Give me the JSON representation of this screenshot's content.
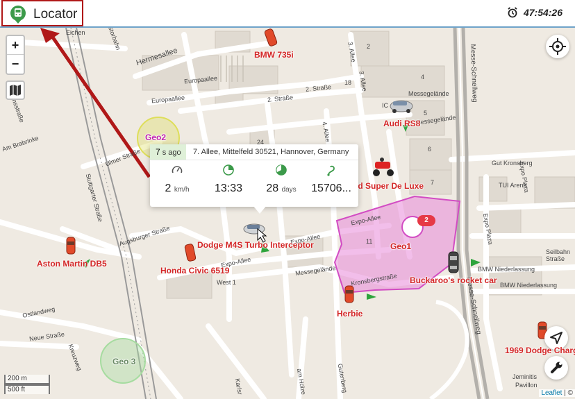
{
  "app": {
    "title": "Locator",
    "clock": "47:54:26"
  },
  "controls": {
    "zoom_in": "+",
    "zoom_out": "−"
  },
  "popup": {
    "ago_value": "7",
    "ago_unit": "s ago",
    "address": "7. Allee, Mittelfeld 30521, Hannover, Germany",
    "speed_value": "2",
    "speed_unit": "km/h",
    "time": "13:33",
    "days_value": "28",
    "days_unit": "days",
    "odometer": "15706..."
  },
  "vehicles": [
    {
      "name": "BMW 735i"
    },
    {
      "name": "Audi RS8"
    },
    {
      "name": "Ford Super De Luxe"
    },
    {
      "name": "Dodge M4S Turbo Interceptor"
    },
    {
      "name": "Honda Civic 6519"
    },
    {
      "name": "Aston Martin DB5"
    },
    {
      "name": "Buckaroo's rocket car"
    },
    {
      "name": "Herbie"
    },
    {
      "name": "1969 Dodge Charg"
    }
  ],
  "geofences": [
    {
      "name": "Geo2"
    },
    {
      "name": "Geo1",
      "count": "2"
    },
    {
      "name": "Geo 3"
    }
  ],
  "streets": [
    "Hermesallee",
    "Europaallee",
    "Europaallee",
    "2. Straße",
    "2. Straße",
    "3. Allee",
    "3. Allee",
    "4. Allee",
    "Messegelände",
    "Messegelände",
    "Messegelände",
    "Messe-Schnellweg",
    "Messe-Schnellweg",
    "Expo-Allee",
    "Expo-Allee",
    "Expo-Allee",
    "Augsburger Straße",
    "Ulmer Straße",
    "Stuttgarter Straße",
    "Ostlandweg",
    "Neue Straße",
    "Am Brabrinke",
    "West 1",
    "Gut Kronsberg",
    "TUI Arena",
    "Expo Plaza",
    "Expo Plaza",
    "Seilbahn Straße",
    "BMW Niederlassung",
    "BMW Niederlassung",
    "Kronsbergstraße",
    "Eichen",
    "Karlsr",
    "Gutenberg",
    "am Holze",
    "Jeminitis",
    "Pavillon",
    "Kreuzweg",
    "ahnsstraße",
    "Kastorbahn",
    "IC"
  ],
  "blocks": [
    "2",
    "4",
    "5",
    "6",
    "7",
    "18",
    "11",
    "24",
    "25"
  ],
  "scale": {
    "meters": "200 m",
    "feet": "500 ft"
  },
  "attribution": {
    "leaflet": "Leaflet",
    "rest": " | ©"
  },
  "colors": {
    "accent_red": "#b01818",
    "geofence_pink": "#e889d8",
    "geofence_yellow": "#dede5a",
    "geofence_green": "#a6dca0",
    "label_red": "#d32626"
  }
}
